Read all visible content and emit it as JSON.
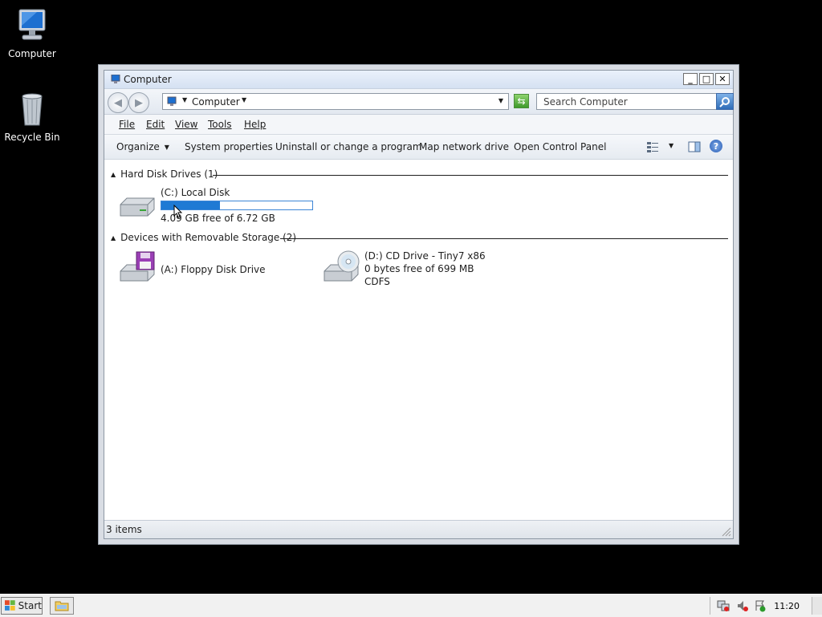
{
  "desktop": {
    "icons": [
      {
        "label": "Computer",
        "icon": "computer-icon"
      },
      {
        "label": "Recycle Bin",
        "icon": "recycle-bin-icon"
      }
    ]
  },
  "window": {
    "title": "Computer",
    "buttons": {
      "minimize": "_",
      "maximize": "□",
      "close": "✕"
    },
    "address": {
      "location": "Computer"
    },
    "search": {
      "placeholder": "Search Computer"
    },
    "menu": [
      "File",
      "Edit",
      "View",
      "Tools",
      "Help"
    ],
    "commands": {
      "organize": "Organize",
      "system_properties": "System properties",
      "uninstall": "Uninstall or change a program",
      "map_drive": "Map network drive",
      "control_panel": "Open Control Panel",
      "help": "?"
    },
    "groups": {
      "hard_disks": {
        "label": "Hard Disk Drives (1)"
      },
      "removable": {
        "label": "Devices with Removable Storage (2)"
      }
    },
    "drives": {
      "c": {
        "name": "(C:) Local Disk",
        "free": "4.09 GB free of 6.72 GB",
        "used_fraction": 0.39
      },
      "a": {
        "name": "(A:) Floppy Disk Drive"
      },
      "d": {
        "name": "(D:) CD Drive - Tiny7 x86",
        "free": "0 bytes free of 699 MB",
        "fs": "CDFS"
      }
    },
    "status": {
      "items": "3 items"
    }
  },
  "taskbar": {
    "start": "Start",
    "clock": "11:20"
  },
  "colors": {
    "accent": "#1f7ad4",
    "desktop": "#000000"
  }
}
